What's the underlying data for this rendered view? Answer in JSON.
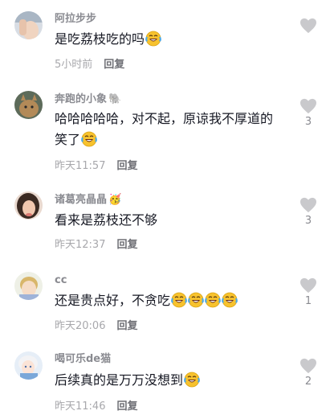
{
  "comments": [
    {
      "username": "阿拉步步",
      "badge": "",
      "text": "是吃荔枝吃的吗",
      "emoji_count": 1,
      "time": "5小时前",
      "reply_label": "回复",
      "likes": "",
      "avatar_icon": "avatar-photo-hand"
    },
    {
      "username": "奔跑的小象",
      "badge": "🐘",
      "text": "哈哈哈哈哈，对不起，原谅我不厚道的笑了",
      "emoji_count": 1,
      "time": "昨天11:57",
      "reply_label": "回复",
      "likes": "3",
      "avatar_icon": "avatar-photo-cat"
    },
    {
      "username": "诸葛亮晶晶",
      "badge": "🥳",
      "text": "看来是荔枝还不够",
      "emoji_count": 0,
      "time": "昨天12:37",
      "reply_label": "回复",
      "likes": "3",
      "avatar_icon": "avatar-photo-woman"
    },
    {
      "username": "cc",
      "badge": "",
      "text": "还是贵点好，不贪吃",
      "emoji_count": 4,
      "time": "昨天20:06",
      "reply_label": "回复",
      "likes": "1",
      "avatar_icon": "avatar-photo-child"
    },
    {
      "username": "喝可乐de猫",
      "badge": "",
      "text": "后续真的是万万没想到",
      "emoji_count": 1,
      "time": "昨天11:46",
      "reply_label": "回复",
      "likes": "2",
      "avatar_icon": "avatar-photo-anime"
    }
  ],
  "emoji_name": "laughing-tears-emoji",
  "like_icon": "heart-icon",
  "colors": {
    "username": "#8a8b91",
    "text": "#161823",
    "meta": "#a8a8ac",
    "reply": "#6f7076",
    "heart": "#c9c9cc"
  }
}
